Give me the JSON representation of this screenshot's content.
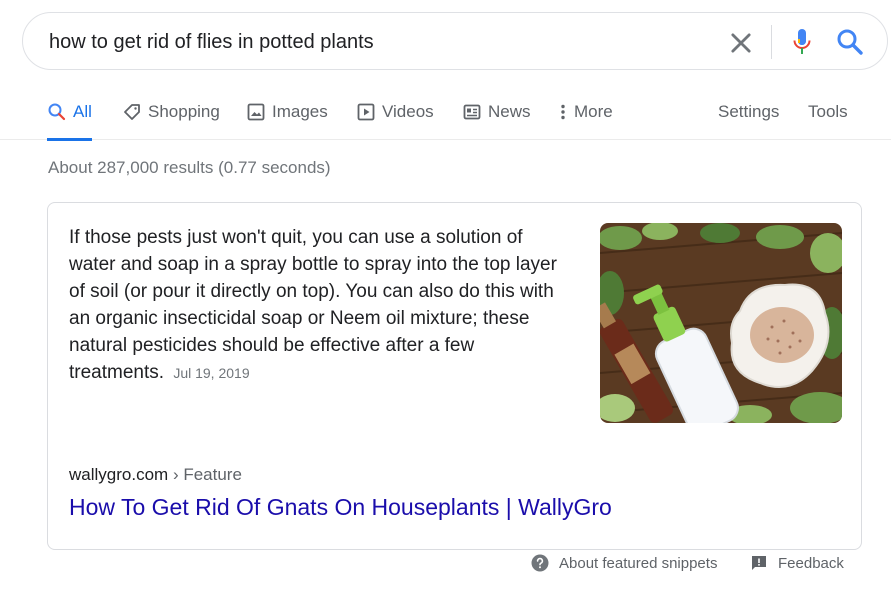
{
  "search": {
    "query": "how to get rid of flies in potted plants"
  },
  "tabs": [
    {
      "label": "All",
      "icon": "search-icon",
      "active": true
    },
    {
      "label": "Shopping",
      "icon": "tag-icon"
    },
    {
      "label": "Images",
      "icon": "image-icon"
    },
    {
      "label": "Videos",
      "icon": "play-icon"
    },
    {
      "label": "News",
      "icon": "newspaper-icon"
    },
    {
      "label": "More",
      "icon": "more-vert-icon"
    },
    {
      "label": "Settings"
    },
    {
      "label": "Tools"
    }
  ],
  "result_stats": "About 287,000 results (0.77 seconds)",
  "snippet": {
    "text": "If those pests just won't quit, you can use a solution of water and soap in a spray bottle to spray into the top layer of soil (or pour it directly on top). You can also do this with an organic insecticidal soap or Neem oil mixture; these natural pesticides should be effective after a few treatments.",
    "date": "Jul 19, 2019",
    "site": "wallygro.com",
    "breadcrumb": "› Feature",
    "title": "How To Get Rid Of Gnats On Houseplants | WallyGro"
  },
  "footer": {
    "about": "About featured snippets",
    "feedback": "Feedback"
  },
  "colors": {
    "link": "#1a0dab",
    "accent": "#1a73e8",
    "muted": "#70757a"
  }
}
